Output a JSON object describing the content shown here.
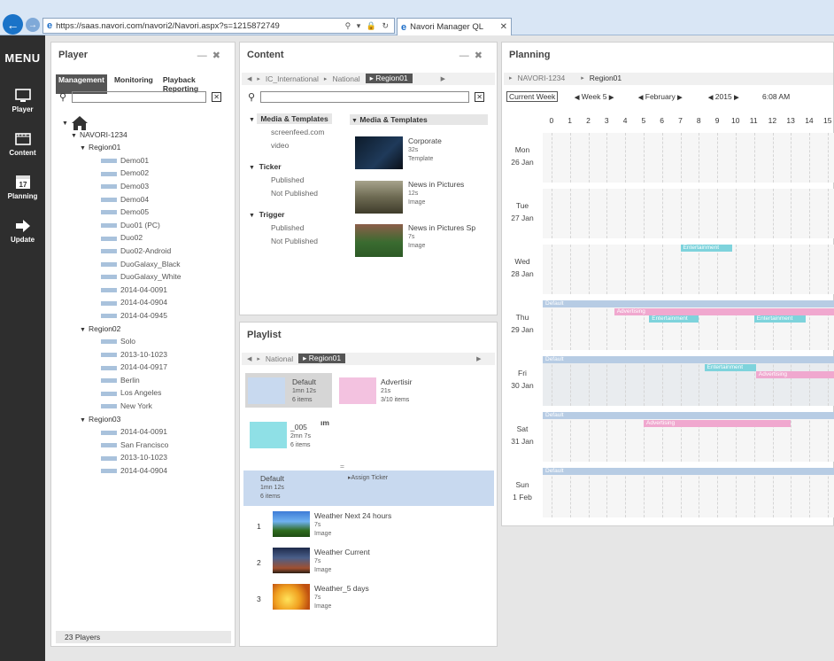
{
  "browser": {
    "url": "https://saas.navori.com/navori2/Navori.aspx?s=1215872749",
    "tab_title": "Navori Manager QL",
    "addr_tools": "⚲ ▾ 🔒 ↻",
    "ie_glyph": "e"
  },
  "sidebar": {
    "menu_label": "MENU",
    "items": [
      {
        "label": "Player",
        "icon": "monitor-icon"
      },
      {
        "label": "Content",
        "icon": "film-icon"
      },
      {
        "label": "Planning",
        "icon": "calendar-icon",
        "icon_text": "17"
      },
      {
        "label": "Update",
        "icon": "arrow-right-icon"
      }
    ]
  },
  "player": {
    "title": "Player",
    "tabs": [
      "Management",
      "Monitoring",
      "Playback Reporting"
    ],
    "tree": {
      "root": "NAVORI-1234",
      "regions": [
        {
          "name": "Region01",
          "devices": [
            "Demo01",
            "Demo02",
            "Demo03",
            "Demo04",
            "Demo05",
            "Duo01 (PC)",
            "Duo02",
            "Duo02-Android",
            "DuoGalaxy_Black",
            "DuoGalaxy_White",
            "2014-04-0091",
            "2014-04-0904",
            "2014-04-0945"
          ]
        },
        {
          "name": "Region02",
          "devices": [
            "Solo",
            "2013-10-1023",
            "2014-04-0917",
            "Berlin",
            "Los Angeles",
            "New York"
          ]
        },
        {
          "name": "Region03",
          "devices": [
            "2014-04-0091",
            "San Francisco",
            "2013-10-1023",
            "2014-04-0904"
          ]
        }
      ]
    },
    "footer": "23 Players"
  },
  "content": {
    "title": "Content",
    "breadcrumb": [
      "IC_International",
      "National",
      "Region01"
    ],
    "groups": [
      {
        "name": "Media & Templates",
        "items": [
          "screenfeed.com",
          "video"
        ]
      },
      {
        "name": "Ticker",
        "items": [
          "Published",
          "Not Published"
        ]
      },
      {
        "name": "Trigger",
        "items": [
          "Published",
          "Not Published"
        ]
      }
    ],
    "list_header": "Media & Templates",
    "media": [
      {
        "title": "Corporate",
        "duration": "32s",
        "type": "Template"
      },
      {
        "title": "News in Pictures",
        "duration": "12s",
        "type": "Image"
      },
      {
        "title": "News in Pictures Sp",
        "duration": "7s",
        "type": "Image"
      }
    ]
  },
  "playlist": {
    "title": "Playlist",
    "breadcrumb": [
      "National",
      "Region01"
    ],
    "tiles": [
      {
        "name": "Default",
        "duration": "1mn 12s",
        "count": "6 items",
        "color": "#c8d9ef"
      },
      {
        "name": "Advertisir",
        "duration": "21s",
        "count": "3/10 items",
        "color": "#f3c2e0"
      },
      {
        "name": "_005",
        "duration": "2mn 7s",
        "count": "6 items",
        "color": "#8fe0e6"
      }
    ],
    "tile_extra": "ım",
    "divider": "=",
    "selected": {
      "name": "Default",
      "duration": "1mn 12s",
      "count": "6 items",
      "assign": "Assign Ticker"
    },
    "items": [
      {
        "num": "1",
        "title": "Weather Next 24 hours",
        "duration": "7s",
        "type": "Image"
      },
      {
        "num": "2",
        "title": "Weather Current",
        "duration": "7s",
        "type": "Image"
      },
      {
        "num": "3",
        "title": "Weather_5 days",
        "duration": "7s",
        "type": "Image"
      }
    ]
  },
  "planning": {
    "title": "Planning",
    "breadcrumb": [
      "NAVORI-1234",
      "Region01"
    ],
    "current_week": "Current Week",
    "week": "Week 5",
    "month": "February",
    "year": "2015",
    "time": "6:08 AM",
    "hours": [
      "0",
      "1",
      "2",
      "3",
      "4",
      "5",
      "6",
      "7",
      "8",
      "9",
      "10",
      "11",
      "12",
      "13",
      "14",
      "15"
    ],
    "days": [
      {
        "name": "Mon",
        "date": "26 Jan",
        "events": []
      },
      {
        "name": "Tue",
        "date": "27 Jan",
        "events": []
      },
      {
        "name": "Wed",
        "date": "28 Jan",
        "events": [
          {
            "label": "Entertainment",
            "kind": "ent",
            "start": 7.0,
            "end": 9.8,
            "lane": 0
          }
        ]
      },
      {
        "name": "Thu",
        "date": "29 Jan",
        "events": [
          {
            "label": "Default",
            "kind": "default",
            "start": 0,
            "end": 16,
            "lane": 0
          },
          {
            "label": "Advertising",
            "kind": "adv",
            "start": 3.4,
            "end": 16,
            "lane": 1
          },
          {
            "label": "Entertainment",
            "kind": "ent",
            "start": 5.3,
            "end": 8.0,
            "lane": 2
          },
          {
            "label": "Entertainment",
            "kind": "ent",
            "start": 11.0,
            "end": 13.8,
            "lane": 2
          }
        ]
      },
      {
        "name": "Fri",
        "date": "30 Jan",
        "events": [
          {
            "label": "Default",
            "kind": "default",
            "start": 0,
            "end": 16,
            "lane": 0
          },
          {
            "label": "Entertainment",
            "kind": "ent",
            "start": 8.3,
            "end": 11.1,
            "lane": 1
          },
          {
            "label": "Advertising",
            "kind": "adv",
            "start": 11.1,
            "end": 15.8,
            "lane": 2
          }
        ]
      },
      {
        "name": "Sat",
        "date": "31 Jan",
        "events": [
          {
            "label": "Default",
            "kind": "default",
            "start": 0,
            "end": 16,
            "lane": 0
          },
          {
            "label": "Advertising",
            "kind": "adv",
            "start": 5.0,
            "end": 13.0,
            "lane": 1
          }
        ]
      },
      {
        "name": "Sun",
        "date": "1 Feb",
        "events": [
          {
            "label": "Default",
            "kind": "default",
            "start": 0,
            "end": 16,
            "lane": 0
          }
        ]
      }
    ]
  },
  "colors": {
    "accent": "#1a73c8",
    "sidebar": "#2e2e2e",
    "default_event": "#b7cce4",
    "entertainment_event": "#7ed3dc",
    "advertising_event": "#f0a8cf"
  }
}
